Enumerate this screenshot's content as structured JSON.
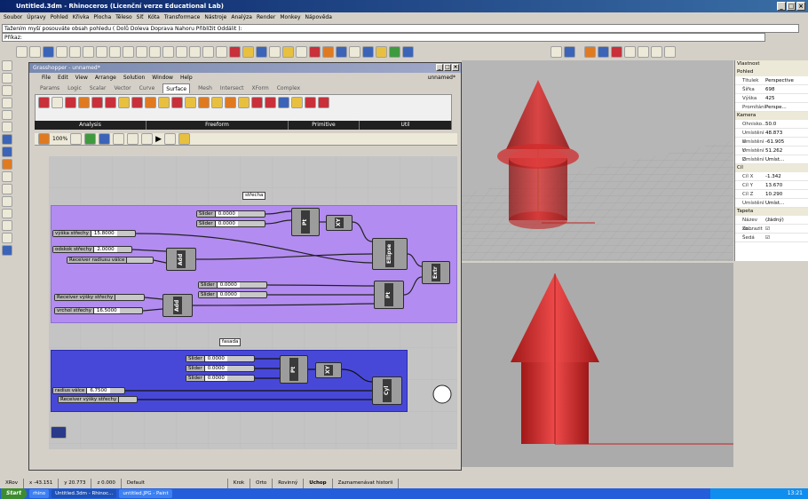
{
  "window": {
    "title": "Untitled.3dm - Rhinoceros (Licenční verze Educational Lab)"
  },
  "menu": [
    "Soubor",
    "Úpravy",
    "Pohled",
    "Křivka",
    "Plocha",
    "Těleso",
    "Síť",
    "Kóta",
    "Transformace",
    "Nástroje",
    "Analýza",
    "Render",
    "Monkey",
    "Nápověda"
  ],
  "command": {
    "history": "Tažením myší posouváte obsah pohledu ( Dolů Doleva Doprava Nahoru Přiblížit Oddálit ):",
    "prompt": "Příkaz:"
  },
  "grasshopper": {
    "title": "Grasshopper - unnamed*",
    "menu": [
      "File",
      "Edit",
      "View",
      "Arrange",
      "Solution",
      "Window",
      "Help"
    ],
    "doc_name": "unnamed*",
    "tabs": [
      "Params",
      "Logic",
      "Scalar",
      "Vector",
      "Curve",
      "Surface",
      "Mesh",
      "Intersect",
      "XForm",
      "Complex"
    ],
    "active_tab": "Surface",
    "ribbon_groups": [
      "Analysis",
      "Freeform",
      "Primitive",
      "Util"
    ],
    "zoom": "100%",
    "groups": {
      "roof": {
        "label": "střecha",
        "sliders": [
          {
            "name": "Slider",
            "value": "0.0000"
          },
          {
            "name": "Slider",
            "value": "0.0000"
          },
          {
            "name": "výška střechy",
            "value": "15.8000"
          },
          {
            "name": "odskok střechy",
            "value": "2.0000"
          },
          {
            "name": "Slider",
            "value": "0.0000"
          },
          {
            "name": "Slider",
            "value": "0.0000"
          },
          {
            "name": "vrchol střechy",
            "value": "16.5000"
          }
        ],
        "receivers": [
          "Receiver radiusu válce",
          "Receiver výšky střechy"
        ],
        "components": [
          "Pt",
          "XY",
          "Add",
          "Ellipse",
          "Pt",
          "Add",
          "Extr"
        ]
      },
      "facade": {
        "label": "fasada",
        "sliders": [
          {
            "name": "Slider",
            "value": "0.0000"
          },
          {
            "name": "Slider",
            "value": "0.0000"
          },
          {
            "name": "Slider",
            "value": "0.0000"
          },
          {
            "name": "radius válce",
            "value": "6.7500"
          }
        ],
        "receivers": [
          "Receiver výšky střechy"
        ],
        "components": [
          "Pt",
          "XY",
          "Cyl"
        ]
      }
    }
  },
  "properties": {
    "title": "Vlastnost",
    "view_section": "Pohled",
    "view": [
      [
        "Titulek",
        "Perspective"
      ],
      [
        "Šířka",
        "698"
      ],
      [
        "Výška",
        "425"
      ],
      [
        "Promítání",
        "Perspe..."
      ]
    ],
    "camera_section": "Kamera",
    "camera": [
      [
        "Ohnisko...",
        "50.0"
      ],
      [
        "Umístění X",
        "48.873"
      ],
      [
        "Umístění Y",
        "-61.905"
      ],
      [
        "Umístění Z",
        "51.262"
      ],
      [
        "Umístění",
        "Umíst..."
      ]
    ],
    "target_section": "Cíl",
    "target": [
      [
        "Cíl X",
        "-1.342"
      ],
      [
        "Cíl Y",
        "13.670"
      ],
      [
        "Cíl Z",
        "10.290"
      ],
      [
        "Umístění",
        "Umíst..."
      ]
    ],
    "wallpaper_section": "Tapeta",
    "wallpaper": [
      [
        "Název so...",
        "(žádný)"
      ],
      [
        "Zobrazit",
        "☑"
      ],
      [
        "Šedá",
        "☑"
      ]
    ]
  },
  "status": {
    "cplane": "XRov",
    "x": "x -43.151",
    "y": "y 20.773",
    "z": "z 0.000",
    "layer": "Default",
    "toggles": [
      "Krok",
      "Orto",
      "Rovinný",
      "Uchop",
      "Zaznamenávat historii"
    ]
  },
  "taskbar": {
    "start": "Start",
    "items": [
      "rhino",
      "Untitled.3dm - Rhinoc...",
      "untitled.JPG - Paint"
    ],
    "clock": "13:21"
  },
  "colors": {
    "accent": "#0a246a",
    "roof_group": "#b28cf0",
    "facade_group": "#4848d8",
    "model": "#c8202a"
  },
  "icons": [
    "close-icon",
    "minimize-icon",
    "maximize-icon",
    "grasshopper-icon",
    "play-icon",
    "gear-icon"
  ]
}
